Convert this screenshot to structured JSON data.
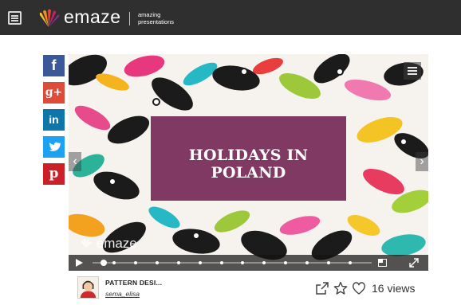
{
  "header": {
    "brand": "emaze",
    "tagline_line1": "amazing",
    "tagline_line2": "presentations"
  },
  "share": {
    "facebook": "f",
    "googleplus": "g+",
    "linkedin": "in",
    "twitter": "t",
    "pinterest": "p"
  },
  "slide": {
    "title": "HOLIDAYS IN POLAND",
    "watermark": "emaze",
    "next_arrow": "›",
    "prev_arrow": "‹"
  },
  "player": {
    "progress": 0.02,
    "slide_markers": 12
  },
  "presentation": {
    "title": "PATTERN DESI...",
    "author": "sema_elisa",
    "views": "16 views"
  },
  "colors": {
    "topbar": "#2f2f2f",
    "facebook": "#3b5998",
    "googleplus": "#dd4b39",
    "linkedin": "#0e76a8",
    "twitter": "#1da1f2",
    "pinterest": "#cb2027",
    "title_box": "#681648"
  },
  "icons": [
    "menu-icon",
    "emaze-logo-icon",
    "share-icon",
    "star-icon",
    "heart-icon",
    "play-icon",
    "fullscreen-icon",
    "thumbnails-icon"
  ]
}
